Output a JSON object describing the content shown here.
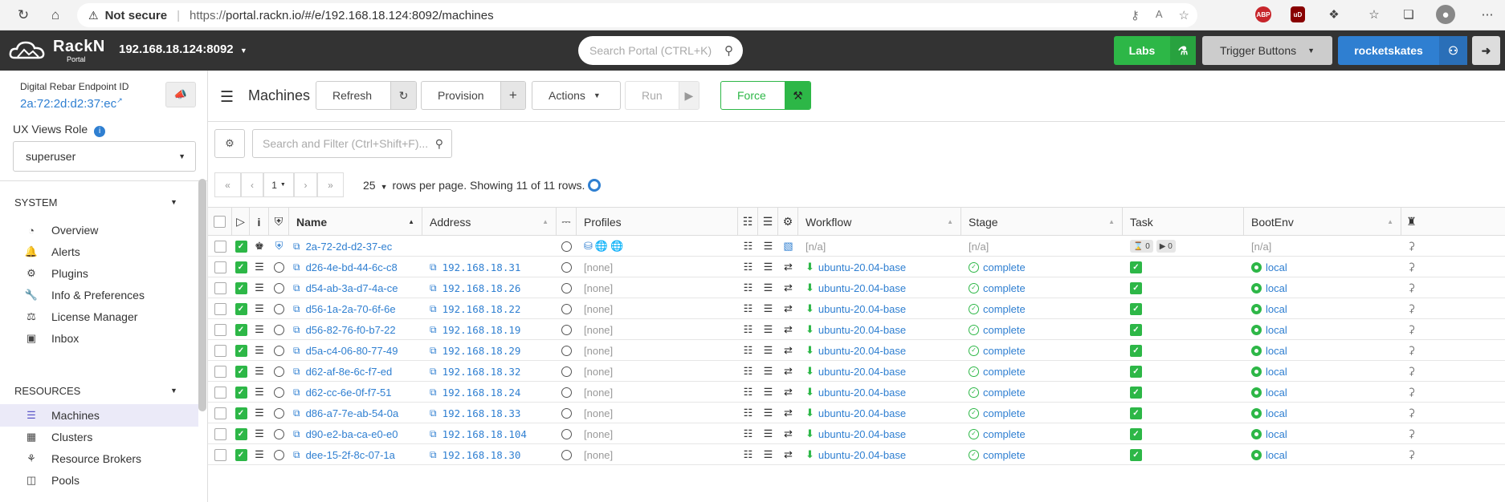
{
  "browser": {
    "not_secure": "Not secure",
    "url_prefix": "https://",
    "url_rest": "portal.rackn.io/#/e/192.168.18.124:8092/machines",
    "ext_abp": "ABP",
    "ext_ublock": "uD"
  },
  "header": {
    "logo_name": "RackN",
    "logo_sub": "Portal",
    "endpoint": "192.168.18.124:8092",
    "search_placeholder": "Search Portal (CTRL+K)",
    "labs": "Labs",
    "trigger_buttons": "Trigger Buttons",
    "user": "rocketskates"
  },
  "sidebar": {
    "endpoint_label": "Digital Rebar Endpoint ID",
    "endpoint_id": "2a:72:2d:d2:37:ec",
    "role_label": "UX Views Role",
    "role_value": "superuser",
    "system_title": "SYSTEM",
    "system_items": [
      "Overview",
      "Alerts",
      "Plugins",
      "Info & Preferences",
      "License Manager",
      "Inbox"
    ],
    "resources_title": "RESOURCES",
    "resources_items": [
      "Machines",
      "Clusters",
      "Resource Brokers",
      "Pools"
    ]
  },
  "toolbar": {
    "title": "Machines",
    "refresh": "Refresh",
    "provision": "Provision",
    "actions": "Actions",
    "run": "Run",
    "force": "Force"
  },
  "filter": {
    "placeholder": "Search and Filter (Ctrl+Shift+F)..."
  },
  "pager": {
    "page": "1",
    "per_page": "25",
    "info": "rows per page. Showing 11 of 11 rows."
  },
  "columns": {
    "name": "Name",
    "address": "Address",
    "profiles": "Profiles",
    "workflow": "Workflow",
    "stage": "Stage",
    "task": "Task",
    "bootenv": "BootEnv"
  },
  "first_row": {
    "name": "2a-72-2d-d2-37-ec",
    "workflow": "[n/a]",
    "stage": "[n/a]",
    "task_a": "0",
    "task_b": "0",
    "bootenv": "[n/a]"
  },
  "rows": [
    {
      "name": "d26-4e-bd-44-6c-c8",
      "address": "192.168.18.31",
      "profiles": "[none]",
      "workflow": "ubuntu-20.04-base",
      "stage": "complete",
      "bootenv": "local"
    },
    {
      "name": "d54-ab-3a-d7-4a-ce",
      "address": "192.168.18.26",
      "profiles": "[none]",
      "workflow": "ubuntu-20.04-base",
      "stage": "complete",
      "bootenv": "local"
    },
    {
      "name": "d56-1a-2a-70-6f-6e",
      "address": "192.168.18.22",
      "profiles": "[none]",
      "workflow": "ubuntu-20.04-base",
      "stage": "complete",
      "bootenv": "local"
    },
    {
      "name": "d56-82-76-f0-b7-22",
      "address": "192.168.18.19",
      "profiles": "[none]",
      "workflow": "ubuntu-20.04-base",
      "stage": "complete",
      "bootenv": "local"
    },
    {
      "name": "d5a-c4-06-80-77-49",
      "address": "192.168.18.29",
      "profiles": "[none]",
      "workflow": "ubuntu-20.04-base",
      "stage": "complete",
      "bootenv": "local"
    },
    {
      "name": "d62-af-8e-6c-f7-ed",
      "address": "192.168.18.32",
      "profiles": "[none]",
      "workflow": "ubuntu-20.04-base",
      "stage": "complete",
      "bootenv": "local"
    },
    {
      "name": "d62-cc-6e-0f-f7-51",
      "address": "192.168.18.24",
      "profiles": "[none]",
      "workflow": "ubuntu-20.04-base",
      "stage": "complete",
      "bootenv": "local"
    },
    {
      "name": "d86-a7-7e-ab-54-0a",
      "address": "192.168.18.33",
      "profiles": "[none]",
      "workflow": "ubuntu-20.04-base",
      "stage": "complete",
      "bootenv": "local"
    },
    {
      "name": "d90-e2-ba-ca-e0-e0",
      "address": "192.168.18.104",
      "profiles": "[none]",
      "workflow": "ubuntu-20.04-base",
      "stage": "complete",
      "bootenv": "local"
    },
    {
      "name": "dee-15-2f-8c-07-1a",
      "address": "192.168.18.30",
      "profiles": "[none]",
      "workflow": "ubuntu-20.04-base",
      "stage": "complete",
      "bootenv": "local"
    }
  ]
}
